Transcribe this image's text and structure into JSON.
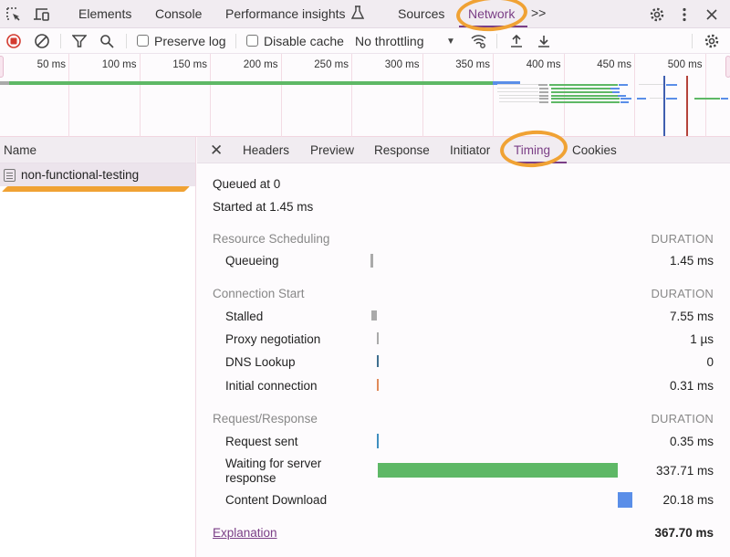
{
  "tabbar": {
    "tabs": [
      {
        "label": "Elements",
        "active": false
      },
      {
        "label": "Console",
        "active": false
      },
      {
        "label": "Performance insights",
        "active": false
      },
      {
        "label": "Sources",
        "active": false
      },
      {
        "label": "Network",
        "active": true
      }
    ],
    "more_label": ">>",
    "icons": [
      "inspect-element-icon",
      "device-toolbar-icon",
      "flask-icon",
      "chevrons-right-icon",
      "settings-gear-icon",
      "kebab-menu-icon",
      "close-icon"
    ]
  },
  "toolbar": {
    "preserve_log": {
      "label": "Preserve log",
      "checked": false
    },
    "disable_cache": {
      "label": "Disable cache",
      "checked": false
    },
    "throttling": {
      "selected": "No throttling"
    }
  },
  "overview": {
    "ticks": [
      "50 ms",
      "100 ms",
      "150 ms",
      "200 ms",
      "250 ms",
      "300 ms",
      "350 ms",
      "400 ms",
      "450 ms",
      "500 ms"
    ],
    "colors": {
      "waiting": "#5eb866",
      "download": "#5a8ee8",
      "queue": "#aaaaaa",
      "dom_content_loaded": "#3f5fb0",
      "load": "#b5433b"
    }
  },
  "request_list": {
    "header": "Name",
    "items": [
      {
        "name": "non-functional-testing",
        "selected": true
      }
    ]
  },
  "details": {
    "tabs": [
      {
        "label": "Headers",
        "active": false
      },
      {
        "label": "Preview",
        "active": false
      },
      {
        "label": "Response",
        "active": false
      },
      {
        "label": "Initiator",
        "active": false
      },
      {
        "label": "Timing",
        "active": true
      },
      {
        "label": "Cookies",
        "active": false
      }
    ],
    "timing": {
      "queued_at": "Queued at 0",
      "started_at": "Started at 1.45 ms",
      "duration_header": "DURATION",
      "sections": [
        {
          "title": "Resource Scheduling",
          "rows": [
            {
              "label": "Queueing",
              "value": "1.45 ms",
              "ms": 1.45,
              "start_ms": 0,
              "color": "#aaaaaa"
            }
          ]
        },
        {
          "title": "Connection Start",
          "rows": [
            {
              "label": "Stalled",
              "value": "7.55 ms",
              "ms": 7.55,
              "start_ms": 1.45,
              "color": "#aaaaaa"
            },
            {
              "label": "Proxy negotiation",
              "value": "1 µs",
              "ms": 0.001,
              "start_ms": 9.0,
              "color": "#aaaaaa"
            },
            {
              "label": "DNS Lookup",
              "value": "0",
              "ms": 0,
              "start_ms": 9.0,
              "color": "#3f6f8f"
            },
            {
              "label": "Initial connection",
              "value": "0.31 ms",
              "ms": 0.31,
              "start_ms": 9.0,
              "color": "#e08a5a"
            }
          ]
        },
        {
          "title": "Request/Response",
          "rows": [
            {
              "label": "Request sent",
              "value": "0.35 ms",
              "ms": 0.35,
              "start_ms": 9.31,
              "color": "#3f8fbf"
            },
            {
              "label": "Waiting for server response",
              "value": "337.71 ms",
              "ms": 337.71,
              "start_ms": 9.66,
              "color": "#5eb866"
            },
            {
              "label": "Content Download",
              "value": "20.18 ms",
              "ms": 20.18,
              "start_ms": 347.37,
              "color": "#5a8ee8"
            }
          ]
        }
      ],
      "explanation_label": "Explanation",
      "total": "367.70 ms",
      "total_ms": 367.7
    }
  }
}
